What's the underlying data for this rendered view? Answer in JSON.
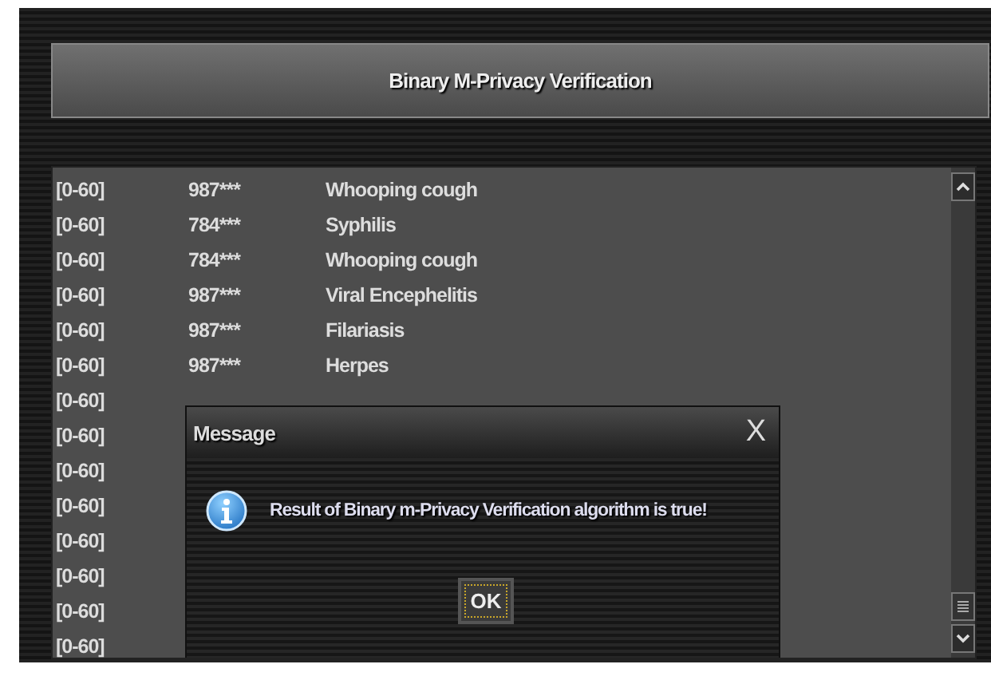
{
  "header": {
    "title": "Binary M-Privacy Verification"
  },
  "table": {
    "rows": [
      {
        "range": "[0-60]",
        "id": "987***",
        "disease": "Whooping cough"
      },
      {
        "range": "[0-60]",
        "id": "784***",
        "disease": "Syphilis"
      },
      {
        "range": "[0-60]",
        "id": "784***",
        "disease": "Whooping cough"
      },
      {
        "range": "[0-60]",
        "id": "987***",
        "disease": "Viral Encephelitis"
      },
      {
        "range": "[0-60]",
        "id": "987***",
        "disease": "Filariasis"
      },
      {
        "range": "[0-60]",
        "id": "987***",
        "disease": "Herpes"
      },
      {
        "range": "[0-60]"
      },
      {
        "range": "[0-60]"
      },
      {
        "range": "[0-60]"
      },
      {
        "range": "[0-60]"
      },
      {
        "range": "[0-60]"
      },
      {
        "range": "[0-60]"
      },
      {
        "range": "[0-60]"
      },
      {
        "range": "[0-60]"
      }
    ]
  },
  "dialog": {
    "title": "Message",
    "close": "X",
    "message": "Result of Binary m-Privacy Verification algorithm is true!",
    "buttons": [
      "OK"
    ]
  }
}
